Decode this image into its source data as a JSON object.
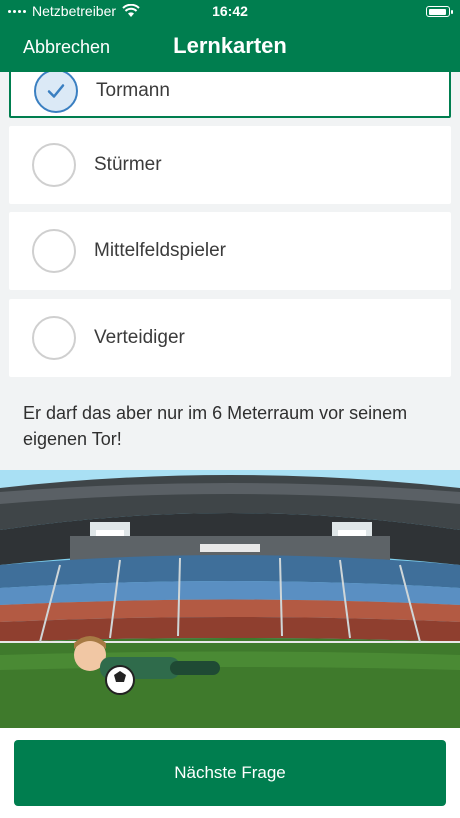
{
  "status": {
    "carrier": "Netzbetreiber",
    "time": "16:42"
  },
  "nav": {
    "cancel_label": "Abbrechen",
    "title": "Lernkarten"
  },
  "options": [
    {
      "label": "Tormann",
      "selected": true
    },
    {
      "label": "Stürmer",
      "selected": false
    },
    {
      "label": "Mittelfeldspieler",
      "selected": false
    },
    {
      "label": "Verteidiger",
      "selected": false
    }
  ],
  "explanation": "Er darf das aber nur im 6 Meterraum vor seinem eigenen Tor!",
  "footer": {
    "next_label": "Nächste Frage"
  },
  "colors": {
    "brand": "#007e4f",
    "selection": "#3a7fc1"
  }
}
